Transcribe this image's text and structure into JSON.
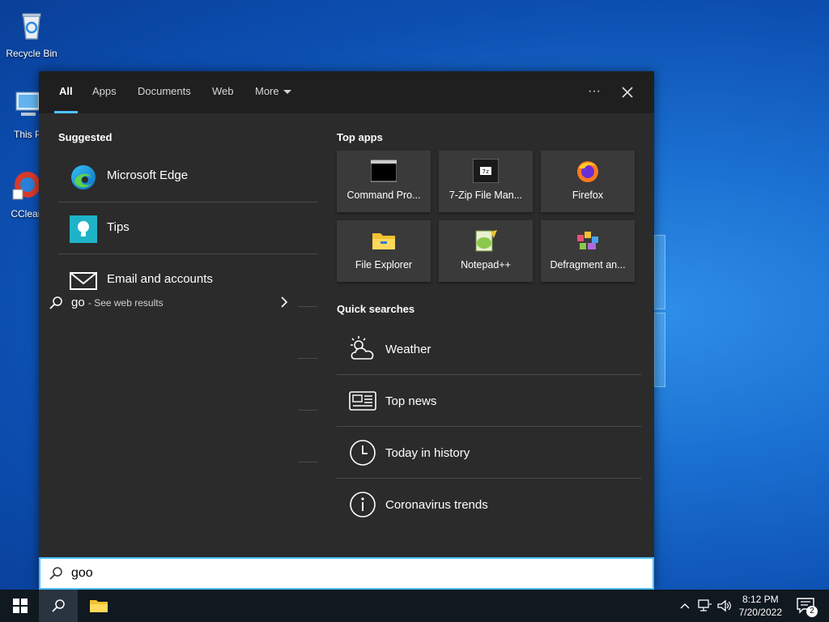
{
  "desktop": {
    "icons": [
      {
        "label": "Recycle Bin"
      },
      {
        "label": "This P"
      },
      {
        "label": "CClear"
      }
    ]
  },
  "tabs": {
    "all": "All",
    "apps": "Apps",
    "documents": "Documents",
    "web": "Web",
    "more": "More",
    "ellipsis": "···"
  },
  "suggested": {
    "title": "Suggested",
    "items": [
      {
        "label": "Microsoft Edge",
        "icon": "edge-icon"
      },
      {
        "label": "Tips",
        "icon": "tips-icon"
      },
      {
        "label": "Email and accounts",
        "icon": "mail-icon"
      }
    ],
    "web": {
      "query": "go",
      "suffix": "- See web results"
    }
  },
  "top_apps": {
    "title": "Top apps",
    "items": [
      {
        "label": "Command Pro...",
        "icon": "command-prompt-icon"
      },
      {
        "label": "7-Zip File Man...",
        "icon": "7zip-icon"
      },
      {
        "label": "Firefox",
        "icon": "firefox-icon"
      },
      {
        "label": "File Explorer",
        "icon": "file-explorer-icon"
      },
      {
        "label": "Notepad++",
        "icon": "notepad-plus-plus-icon"
      },
      {
        "label": "Defragment an...",
        "icon": "defragment-icon"
      }
    ]
  },
  "quick_searches": {
    "title": "Quick searches",
    "items": [
      {
        "label": "Weather",
        "icon": "weather-icon"
      },
      {
        "label": "Top news",
        "icon": "news-icon"
      },
      {
        "label": "Today in history",
        "icon": "clock-icon"
      },
      {
        "label": "Coronavirus trends",
        "icon": "info-icon"
      }
    ]
  },
  "search": {
    "value": "goo"
  },
  "taskbar": {
    "time": "8:12 PM",
    "date": "7/20/2022",
    "notifications": "2"
  },
  "colors": {
    "accent": "#4cc2ff",
    "panel": "#2b2b2b",
    "tabbar": "#1f1f1f"
  }
}
